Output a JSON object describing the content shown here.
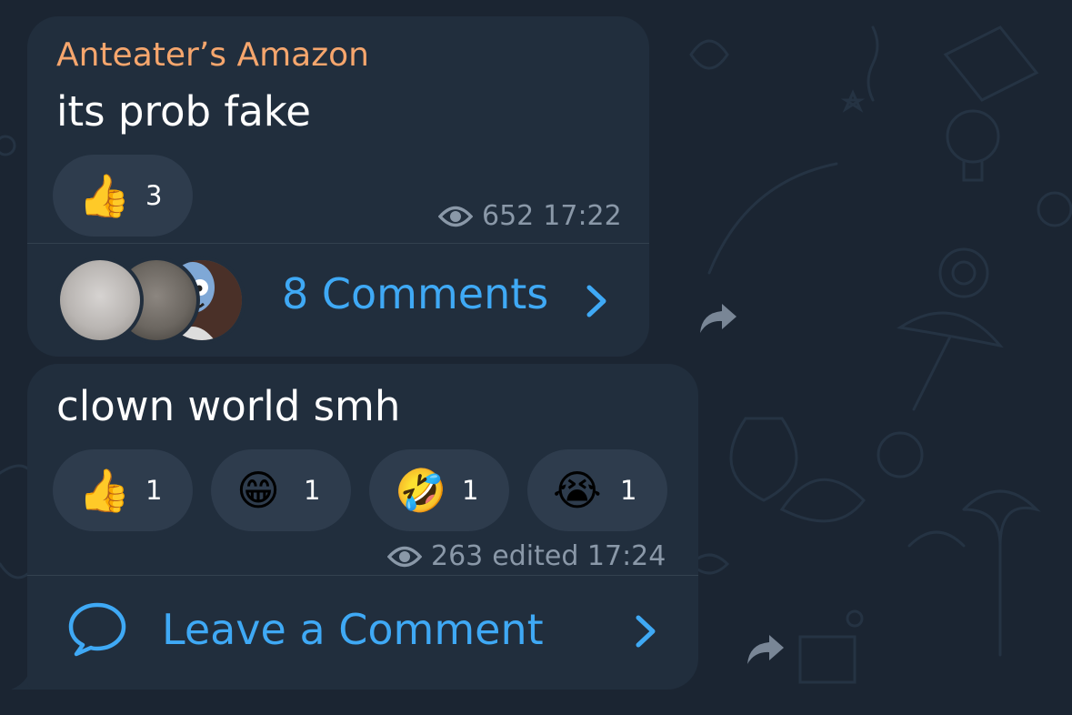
{
  "post1": {
    "author": "Anteater’s Amazon",
    "text": "its prob fake",
    "reactions": [
      {
        "emoji": "👍",
        "icon": "thumbs-up",
        "count": "3"
      }
    ],
    "views": "652",
    "time": "17:22",
    "comments_label": "8 Comments",
    "avatars": [
      "blurred-avatar",
      "blurred-avatar",
      "cartoon-alien-avatar"
    ]
  },
  "post2": {
    "text": "clown world smh",
    "reactions": [
      {
        "emoji": "👍",
        "icon": "thumbs-up",
        "count": "1"
      },
      {
        "emoji": "😁",
        "icon": "grinning-face",
        "count": "1"
      },
      {
        "emoji": "🤣",
        "icon": "rolling-laughing-face",
        "count": "1"
      },
      {
        "emoji": "😭",
        "icon": "loudly-crying-face",
        "count": "1"
      }
    ],
    "views": "263",
    "time_label": "edited 17:24",
    "leave_comment_label": "Leave a Comment"
  },
  "colors": {
    "background": "#1b2532",
    "bubble": "#212e3d",
    "author": "#f6a66d",
    "link": "#3fa9f5",
    "meta": "#8a98a8",
    "reaction_pill": "#2e3c4d"
  }
}
